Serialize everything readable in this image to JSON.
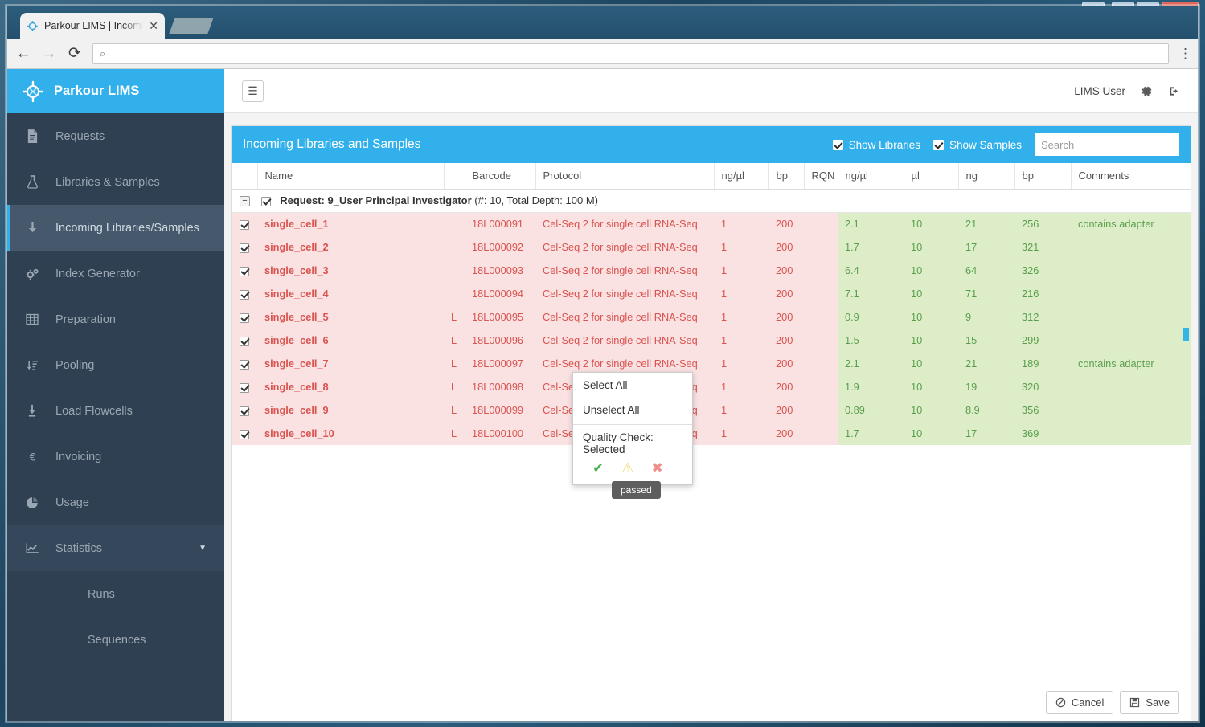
{
  "window": {
    "buttons": {
      "user": "user-icon",
      "minimize": "—",
      "maximize": "□",
      "close": "✕"
    }
  },
  "browser": {
    "tab_title": "Parkour LIMS | Incoming",
    "tab_close": "✕",
    "back": "←",
    "forward": "→",
    "reload": "⟳",
    "search_glyph": "⌕",
    "url_value": "",
    "url_placeholder": "",
    "menu": "⋮"
  },
  "sidebar": {
    "brand": "Parkour LIMS",
    "items": [
      {
        "label": "Requests",
        "icon": "document-icon",
        "state": ""
      },
      {
        "label": "Libraries & Samples",
        "icon": "flask-icon",
        "state": ""
      },
      {
        "label": "Incoming Libraries/Samples",
        "icon": "download-arrow-icon",
        "state": "active"
      },
      {
        "label": "Index Generator",
        "icon": "gears-icon",
        "state": ""
      },
      {
        "label": "Preparation",
        "icon": "table-icon",
        "state": ""
      },
      {
        "label": "Pooling",
        "icon": "sort-icon",
        "state": ""
      },
      {
        "label": "Load Flowcells",
        "icon": "arrow-down-bar-icon",
        "state": ""
      },
      {
        "label": "Invoicing",
        "icon": "euro-icon",
        "state": ""
      },
      {
        "label": "Usage",
        "icon": "pie-chart-icon",
        "state": ""
      },
      {
        "label": "Statistics",
        "icon": "line-chart-icon",
        "state": "open",
        "caret": "▼"
      }
    ],
    "sub_items": [
      {
        "label": "Runs"
      },
      {
        "label": "Sequences"
      }
    ]
  },
  "topbar": {
    "hamburger": "☰",
    "user_name": "LIMS User",
    "gear_icon": "gear-icon",
    "logout_icon": "logout-icon"
  },
  "panel": {
    "title": "Incoming Libraries and Samples",
    "show_libraries_label": "Show Libraries",
    "show_libraries_checked": true,
    "show_samples_label": "Show Samples",
    "show_samples_checked": true,
    "search_value": "",
    "search_placeholder": "Search"
  },
  "table": {
    "columns": [
      "",
      "Name",
      "",
      "Barcode",
      "Protocol",
      "ng/µl",
      "bp",
      "RQN",
      "ng/µl",
      "µl",
      "ng",
      "bp",
      "Comments"
    ],
    "group": {
      "collapse_glyph": "−",
      "checked": true,
      "title": "Request: 9_User Principal Investigator",
      "meta": "(#: 10, Total Depth: 100 M)"
    },
    "rows": [
      {
        "checked": true,
        "name": "single_cell_1",
        "type": "",
        "barcode": "18L000091",
        "protocol": "Cel-Seq 2 for single cell RNA-Seq",
        "ngul_a": "1",
        "bp_a": "200",
        "rqn": "",
        "ngul_b": "2.1",
        "ul": "10",
        "ng": "21",
        "bp_b": "256",
        "comments": "contains adapter"
      },
      {
        "checked": true,
        "name": "single_cell_2",
        "type": "",
        "barcode": "18L000092",
        "protocol": "Cel-Seq 2 for single cell RNA-Seq",
        "ngul_a": "1",
        "bp_a": "200",
        "rqn": "",
        "ngul_b": "1.7",
        "ul": "10",
        "ng": "17",
        "bp_b": "321",
        "comments": ""
      },
      {
        "checked": true,
        "name": "single_cell_3",
        "type": "",
        "barcode": "18L000093",
        "protocol": "Cel-Seq 2 for single cell RNA-Seq",
        "ngul_a": "1",
        "bp_a": "200",
        "rqn": "",
        "ngul_b": "6.4",
        "ul": "10",
        "ng": "64",
        "bp_b": "326",
        "comments": ""
      },
      {
        "checked": true,
        "name": "single_cell_4",
        "type": "",
        "barcode": "18L000094",
        "protocol": "Cel-Seq 2 for single cell RNA-Seq",
        "ngul_a": "1",
        "bp_a": "200",
        "rqn": "",
        "ngul_b": "7.1",
        "ul": "10",
        "ng": "71",
        "bp_b": "216",
        "comments": ""
      },
      {
        "checked": true,
        "name": "single_cell_5",
        "type": "L",
        "barcode": "18L000095",
        "protocol": "Cel-Seq 2 for single cell RNA-Seq",
        "ngul_a": "1",
        "bp_a": "200",
        "rqn": "",
        "ngul_b": "0.9",
        "ul": "10",
        "ng": "9",
        "bp_b": "312",
        "comments": ""
      },
      {
        "checked": true,
        "name": "single_cell_6",
        "type": "L",
        "barcode": "18L000096",
        "protocol": "Cel-Seq 2 for single cell RNA-Seq",
        "ngul_a": "1",
        "bp_a": "200",
        "rqn": "",
        "ngul_b": "1.5",
        "ul": "10",
        "ng": "15",
        "bp_b": "299",
        "comments": ""
      },
      {
        "checked": true,
        "name": "single_cell_7",
        "type": "L",
        "barcode": "18L000097",
        "protocol": "Cel-Seq 2 for single cell RNA-Seq",
        "ngul_a": "1",
        "bp_a": "200",
        "rqn": "",
        "ngul_b": "2.1",
        "ul": "10",
        "ng": "21",
        "bp_b": "189",
        "comments": "contains adapter"
      },
      {
        "checked": true,
        "name": "single_cell_8",
        "type": "L",
        "barcode": "18L000098",
        "protocol": "Cel-Seq 2 for single cell RNA-Seq",
        "ngul_a": "1",
        "bp_a": "200",
        "rqn": "",
        "ngul_b": "1.9",
        "ul": "10",
        "ng": "19",
        "bp_b": "320",
        "comments": ""
      },
      {
        "checked": true,
        "name": "single_cell_9",
        "type": "L",
        "barcode": "18L000099",
        "protocol": "Cel-Seq 2 for single cell RNA-Seq",
        "ngul_a": "1",
        "bp_a": "200",
        "rqn": "",
        "ngul_b": "0.89",
        "ul": "10",
        "ng": "8.9",
        "bp_b": "356",
        "comments": ""
      },
      {
        "checked": true,
        "name": "single_cell_10",
        "type": "L",
        "barcode": "18L000100",
        "protocol": "Cel-Seq 2 for single cell RNA-Seq",
        "ngul_a": "1",
        "bp_a": "200",
        "rqn": "",
        "ngul_b": "1.7",
        "ul": "10",
        "ng": "17",
        "bp_b": "369",
        "comments": ""
      }
    ]
  },
  "context_menu": {
    "select_all": "Select All",
    "unselect_all": "Unselect All",
    "quality_check_label": "Quality Check: Selected",
    "quality_icons": [
      {
        "name": "quality-passed-icon",
        "glyph": "✔"
      },
      {
        "name": "quality-warning-icon",
        "glyph": "⚠"
      },
      {
        "name": "quality-failed-icon",
        "glyph": "✖"
      }
    ]
  },
  "tooltip": {
    "text": "passed"
  },
  "footer": {
    "cancel_label": "Cancel",
    "cancel_icon": "ban-icon",
    "save_label": "Save",
    "save_icon": "floppy-disk-icon"
  },
  "colors": {
    "brand_blue": "#31b0eb",
    "sidebar_dark": "#2f4052",
    "row_fail_bg": "#fae2e3",
    "row_fail_text": "#d9534f",
    "row_pass_bg": "#dcedc8",
    "row_pass_text": "#5a9e4d"
  }
}
